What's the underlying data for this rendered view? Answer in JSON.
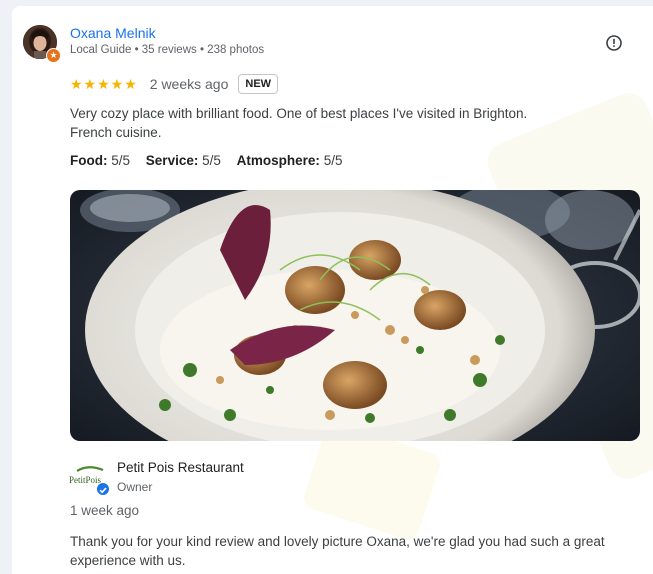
{
  "review": {
    "author": "Oxana Melnik",
    "author_meta": "Local Guide • 35 reviews • 238 photos",
    "stars": "★★★★★",
    "rating": 5,
    "date": "2 weeks ago",
    "badge": "NEW",
    "text_line1": "Very cozy place with brilliant food. One of best places I've visited in Brighton.",
    "text_line2": "French cuisine.",
    "aspects": [
      {
        "label": "Food:",
        "value": "5/5"
      },
      {
        "label": "Service:",
        "value": "5/5"
      },
      {
        "label": "Atmosphere:",
        "value": "5/5"
      }
    ],
    "icons": {
      "avatar": "avatar-photo",
      "local_guide": "local-guide-badge-icon",
      "more": "report-icon"
    }
  },
  "owner_reply": {
    "logo_text": "PetitPois",
    "name": "Petit Pois Restaurant",
    "role": "Owner",
    "date": "1 week ago",
    "text_line1": "Thank you for your kind review and lovely picture Oxana, we're glad you had such a great",
    "text_line2": "experience with us."
  },
  "colors": {
    "link": "#1a73e8",
    "star": "#f5b400",
    "badge_orange": "#e8711a",
    "text_secondary": "#5f6368"
  }
}
